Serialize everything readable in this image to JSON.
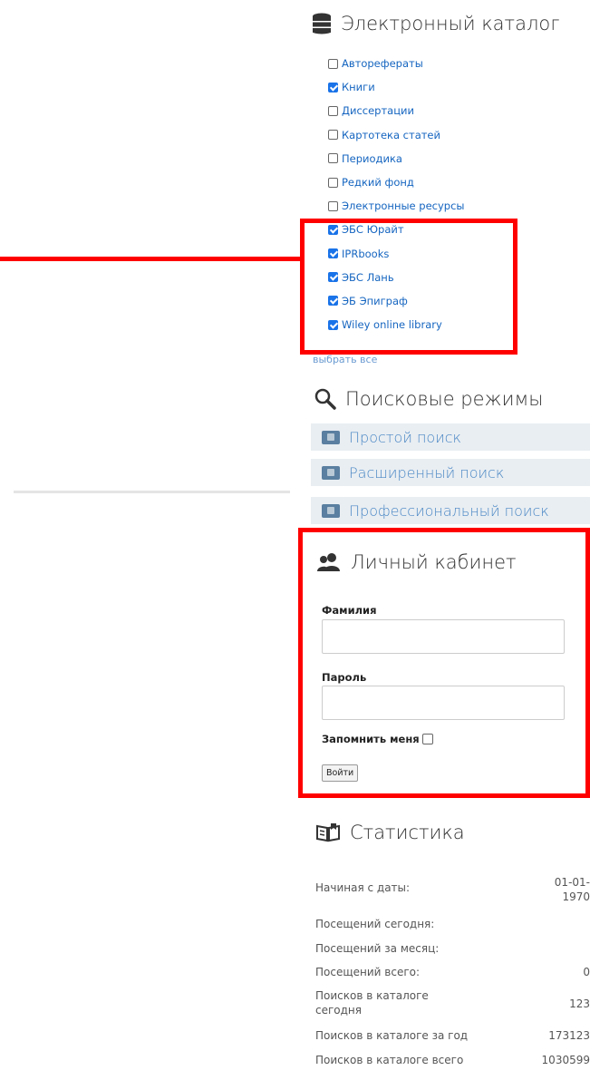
{
  "catalog": {
    "title": "Электронный каталог",
    "items": [
      {
        "label": "Авторефераты",
        "checked": false
      },
      {
        "label": "Книги",
        "checked": true
      },
      {
        "label": "Диссертации",
        "checked": false
      },
      {
        "label": "Картотека статей",
        "checked": false
      },
      {
        "label": "Периодика",
        "checked": false
      },
      {
        "label": "Редкий фонд",
        "checked": false
      },
      {
        "label": "Электронные ресурсы",
        "checked": false
      },
      {
        "label": "ЭБС Юрайт",
        "checked": true
      },
      {
        "label": "IPRbooks",
        "checked": true
      },
      {
        "label": "ЭБС Лань",
        "checked": true
      },
      {
        "label": "ЭБ Эпиграф",
        "checked": true
      },
      {
        "label": "Wiley online library",
        "checked": true
      }
    ],
    "select_all": "выбрать все"
  },
  "search_modes": {
    "title": "Поисковые режимы",
    "items": [
      {
        "label": "Простой поиск"
      },
      {
        "label": "Расширенный поиск"
      },
      {
        "label": "Профессиональный поиск"
      }
    ]
  },
  "account": {
    "title": "Личный кабинет",
    "surname_label": "Фамилия",
    "surname_value": "",
    "password_label": "Пароль",
    "password_value": "",
    "remember_label": "Запомнить меня",
    "remember_checked": false,
    "login_button": "Войти"
  },
  "stats": {
    "title": "Статистика",
    "rows": [
      {
        "label": "Начиная с даты:",
        "value": "01-01-1970"
      },
      {
        "label": "Посещений сегодня:",
        "value": ""
      },
      {
        "label": "Посещений за месяц:",
        "value": ""
      },
      {
        "label": "Посещений всего:",
        "value": "0"
      },
      {
        "label": "Поисков в каталоге сегодня",
        "value": "123"
      },
      {
        "label": "Поисков в каталоге за год",
        "value": "173123"
      },
      {
        "label": "Поисков в каталоге всего",
        "value": "1030599"
      }
    ]
  },
  "colors": {
    "highlight": "#ff0000",
    "link": "#1565c0",
    "mode_bg": "#e9eef2",
    "checkbox": "#1a73e8"
  },
  "icons": {
    "catalog": "database-icon",
    "search": "magnifier-icon",
    "account": "users-icon",
    "stats": "open-book-icon",
    "mode": "browser-window-icon"
  }
}
